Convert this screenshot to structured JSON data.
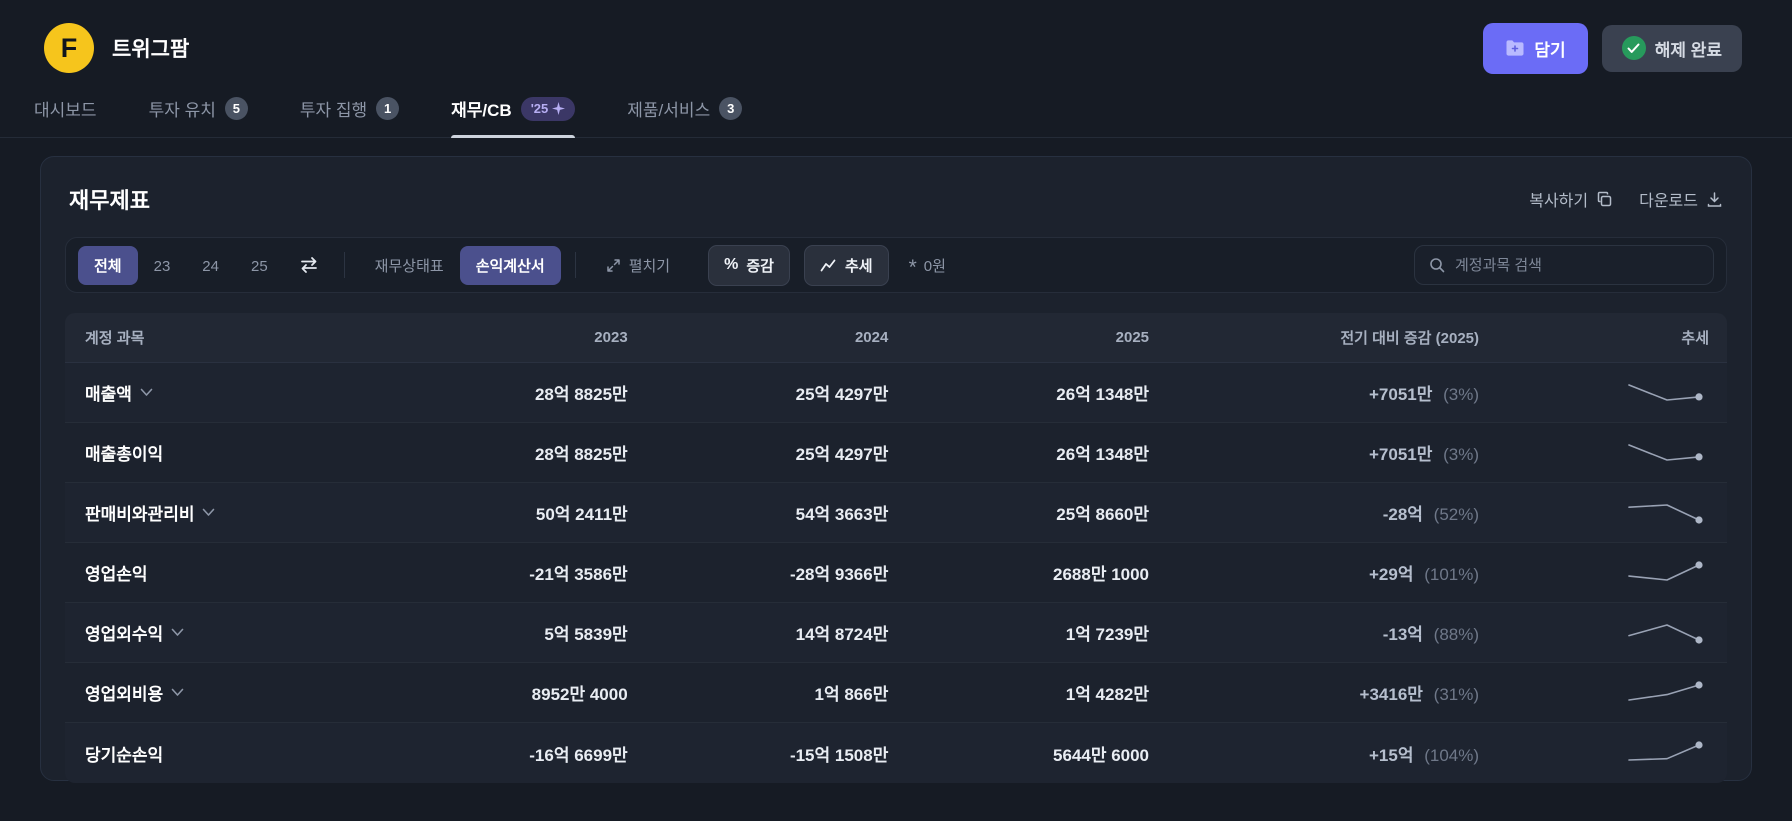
{
  "colors": {
    "accent": "#6b6cf6",
    "chip_active": "#4b508d",
    "logo_yellow": "#f6c51c",
    "success_green": "#279a5c",
    "badge_purple_bg": "#3b3766",
    "badge_purple_text": "#b7aef3"
  },
  "brand": {
    "name": "트위그팜",
    "logo_letter": "F"
  },
  "header": {
    "add_label": "담기",
    "done_label": "해제 완료"
  },
  "tabs": [
    {
      "label": "대시보드",
      "badge": null,
      "active": false
    },
    {
      "label": "투자 유치",
      "badge": "5",
      "active": false
    },
    {
      "label": "투자 집행",
      "badge": "1",
      "active": false
    },
    {
      "label": "재무/CB",
      "badge": "'25",
      "badge_style": "purple",
      "active": true
    },
    {
      "label": "제품/서비스",
      "badge": "3",
      "active": false
    }
  ],
  "card": {
    "title": "재무제표",
    "copy_label": "복사하기",
    "download_label": "다운로드"
  },
  "toolbar": {
    "years": [
      "전체",
      "23",
      "24",
      "25"
    ],
    "year_active": "전체",
    "statements": [
      "재무상태표",
      "손익계산서"
    ],
    "statement_active": "손익계산서",
    "expand_label": "펼치기",
    "delta_label": "증감",
    "trend_label": "추세",
    "zero_label": "0원",
    "search_placeholder": "계정과목 검색"
  },
  "table": {
    "headers": {
      "account": "계정 과목",
      "y2023": "2023",
      "y2024": "2024",
      "y2025": "2025",
      "delta": "전기 대비 증감 (2025)",
      "trend": "추세"
    },
    "rows": [
      {
        "account": "매출액",
        "expandable": true,
        "y2023": "28억 8825만",
        "y2024": "25억 4297만",
        "y2025": "26억 1348만",
        "delta": "+7051만",
        "delta_pct": "(3%)",
        "trend": [
          288825,
          254297,
          261348
        ]
      },
      {
        "account": "매출총이익",
        "expandable": false,
        "y2023": "28억 8825만",
        "y2024": "25억 4297만",
        "y2025": "26억 1348만",
        "delta": "+7051만",
        "delta_pct": "(3%)",
        "trend": [
          288825,
          254297,
          261348
        ]
      },
      {
        "account": "판매비와관리비",
        "expandable": true,
        "y2023": "50억 2411만",
        "y2024": "54억 3663만",
        "y2025": "25억 8660만",
        "delta": "-28억",
        "delta_pct": "(52%)",
        "trend": [
          502411,
          543663,
          258660
        ]
      },
      {
        "account": "영업손익",
        "expandable": false,
        "y2023": "-21억 3586만",
        "y2024": "-28억 9366만",
        "y2025": "2688만 1000",
        "delta": "+29억",
        "delta_pct": "(101%)",
        "trend": [
          -213586,
          -289366,
          2688
        ]
      },
      {
        "account": "영업외수익",
        "expandable": true,
        "y2023": "5억 5839만",
        "y2024": "14억 8724만",
        "y2025": "1억 7239만",
        "delta": "-13억",
        "delta_pct": "(88%)",
        "trend": [
          55839,
          148724,
          17239
        ]
      },
      {
        "account": "영업외비용",
        "expandable": true,
        "y2023": "8952만 4000",
        "y2024": "1억 866만",
        "y2025": "1억 4282만",
        "delta": "+3416만",
        "delta_pct": "(31%)",
        "trend": [
          8952,
          10866,
          14282
        ]
      },
      {
        "account": "당기순손익",
        "expandable": false,
        "y2023": "-16억 6699만",
        "y2024": "-15억 1508만",
        "y2025": "5644만 6000",
        "delta": "+15억",
        "delta_pct": "(104%)",
        "trend": [
          -166699,
          -151508,
          5645
        ]
      }
    ]
  }
}
